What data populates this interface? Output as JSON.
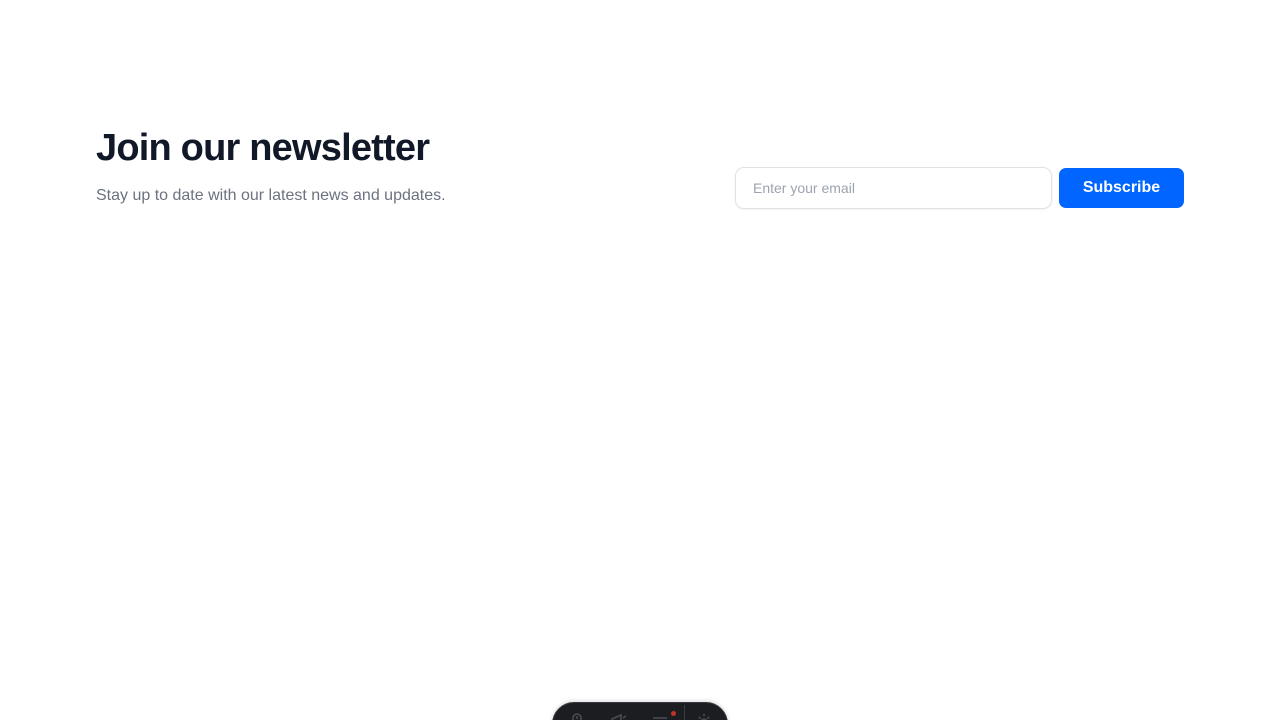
{
  "newsletter": {
    "heading": "Join our newsletter",
    "subtext": "Stay up to date with our latest news and updates.",
    "email_placeholder": "Enter your email",
    "email_value": "",
    "subscribe_label": "Subscribe"
  },
  "dock": {
    "icons": [
      "mouse-icon",
      "megaphone-icon",
      "menu-icon",
      "gear-icon"
    ],
    "has_notification": true
  },
  "colors": {
    "accent": "#0066ff",
    "heading": "#111827",
    "muted": "#6b7280",
    "dock_bg": "#1c1d21",
    "notification": "#c4302b"
  }
}
